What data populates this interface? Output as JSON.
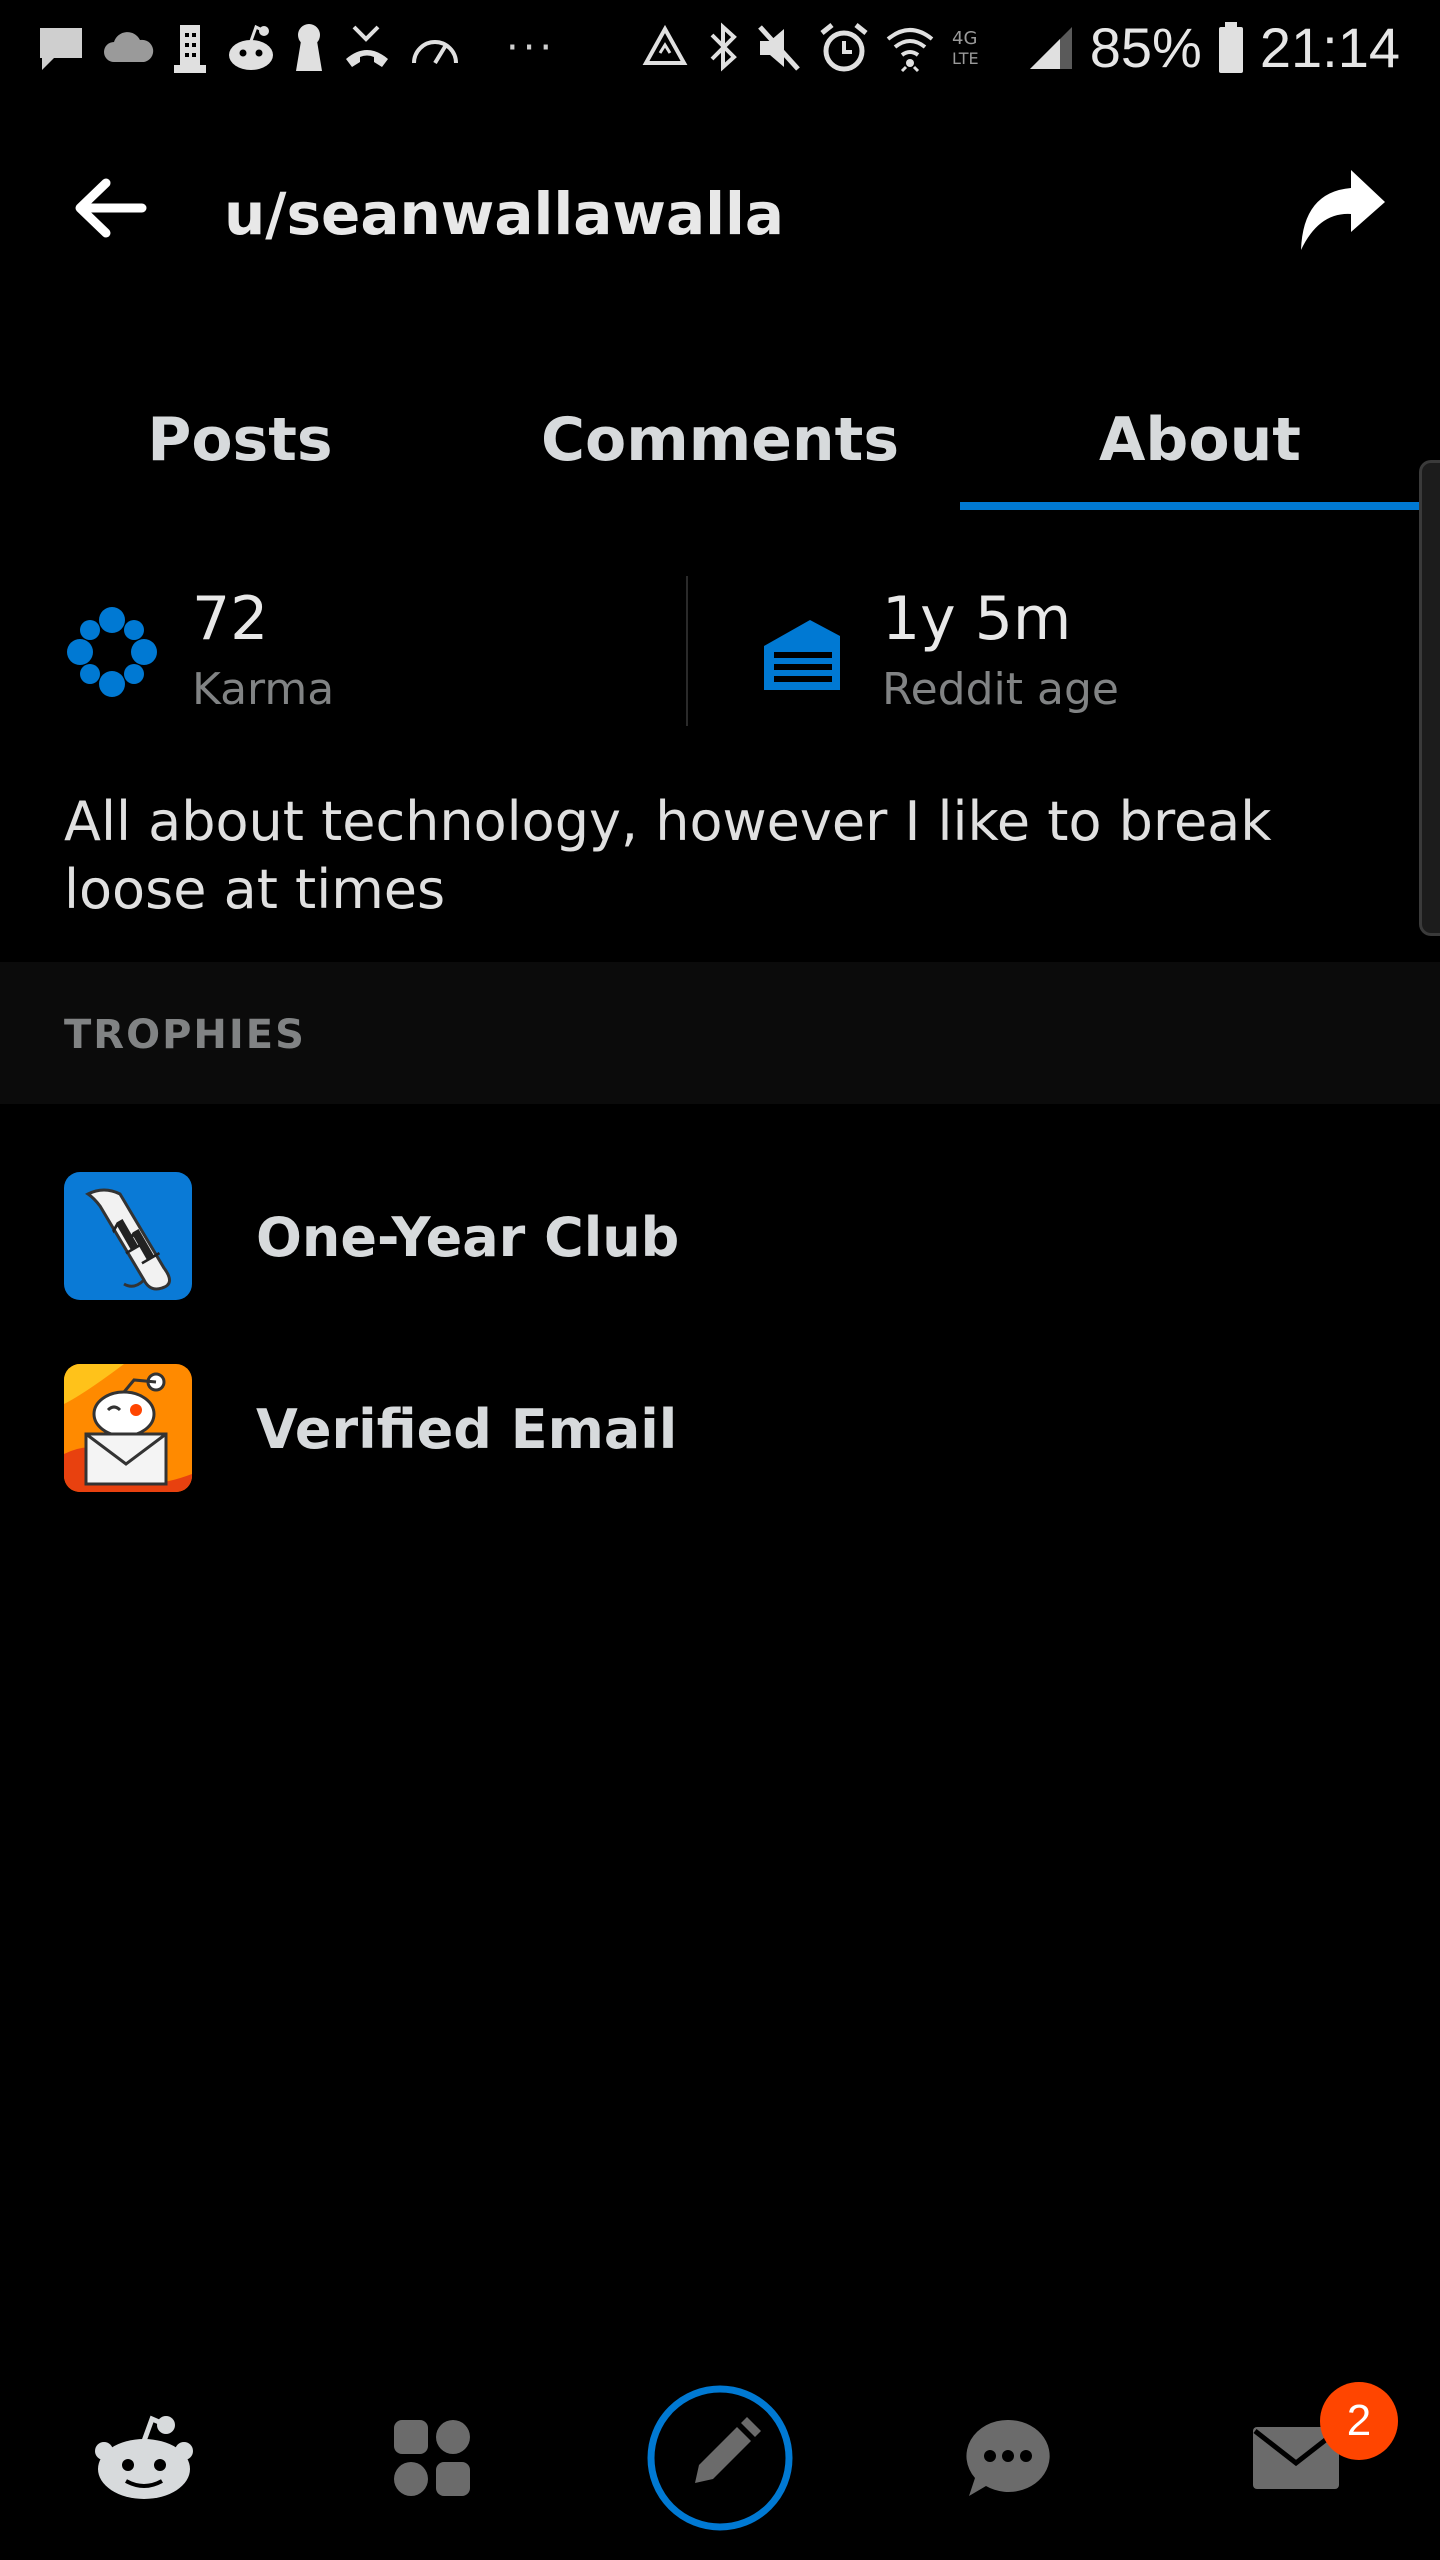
{
  "status_bar": {
    "battery_percent": "85%",
    "time": "21:14",
    "overflow": "···",
    "network_type": "4G LTE",
    "left_icons": [
      "message-icon",
      "cloud-icon",
      "building-icon",
      "reddit-icon",
      "keyhole-icon",
      "missed-call-icon",
      "speedometer-icon"
    ],
    "right_icons": [
      "recycle-icon",
      "bluetooth-icon",
      "mute-icon",
      "alarm-icon",
      "wifi-icon",
      "lte-icon",
      "signal-icon",
      "battery-icon"
    ]
  },
  "header": {
    "title": "u/seanwallawalla",
    "back_icon": "arrow-left-icon",
    "share_icon": "share-icon"
  },
  "tabs": [
    {
      "label": "Posts",
      "selected": false
    },
    {
      "label": "Comments",
      "selected": false
    },
    {
      "label": "About",
      "selected": true
    }
  ],
  "stats": {
    "karma": {
      "value": "72",
      "label": "Karma"
    },
    "age": {
      "value": "1y 5m",
      "label": "Reddit age"
    }
  },
  "bio": "All about technology, however I like to break loose at times",
  "trophies": {
    "header": "TROPHIES",
    "items": [
      {
        "name": "One-Year Club",
        "icon": "one-year-club-icon"
      },
      {
        "name": "Verified Email",
        "icon": "verified-email-icon"
      }
    ]
  },
  "bottom_nav": {
    "items": [
      "home-icon",
      "communities-icon",
      "create-post-icon",
      "chat-icon",
      "inbox-icon"
    ],
    "inbox_badge": "2"
  },
  "colors": {
    "background": "#000000",
    "accent": "#0079d3",
    "badge": "#ff4500",
    "muted": "#818384"
  }
}
